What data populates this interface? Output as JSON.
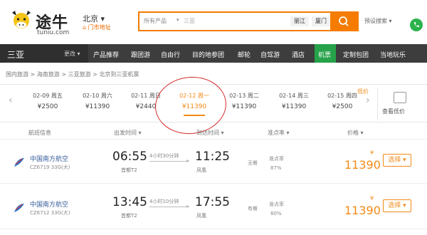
{
  "header": {
    "logo_cn": "途牛",
    "logo_en": "tuniu.com",
    "city": "北京 ▾",
    "city_sub": "⌂ 门市地址",
    "search": {
      "category": "所有产品",
      "value": "三亚",
      "tags": [
        "丽江",
        "厦门"
      ]
    },
    "link": "预设搜索 ▾"
  },
  "nav": {
    "city": "三亚",
    "change": "更改 ▾",
    "items": [
      "产品推荐",
      "跟团游",
      "自由行",
      "目的地参团",
      "邮轮",
      "自驾游",
      "酒店",
      "机票",
      "定制包团",
      "当地玩乐"
    ],
    "colors": {
      "active": "#26a24a",
      "bar": "#3d3d3d"
    }
  },
  "breadcrumb": "国内旅游 > 海南旅游 > 三亚旅游 > 北京到三亚机票",
  "dates": [
    {
      "label": "02-09 周五",
      "price": "¥2500"
    },
    {
      "label": "02-10 周六",
      "price": "¥11390"
    },
    {
      "label": "02-11 周日",
      "price": "¥2440"
    },
    {
      "label": "02-12 周一",
      "price": "¥11390"
    },
    {
      "label": "02-13 周二",
      "price": "¥11390"
    },
    {
      "label": "02-14 周三",
      "price": "¥11390"
    },
    {
      "label": "02-15 周四",
      "price": "¥2500"
    }
  ],
  "low_badge": "低价",
  "calendar_label": "查看低价",
  "table_header": [
    "航班信息",
    "出发时间 ▾",
    "到达时间 ▾",
    "准点率 ▾",
    "价格 ▾"
  ],
  "flights": [
    {
      "airline": "中国南方航空",
      "code": "CZ6719 33G(大)",
      "dep_time": "06:55",
      "dep_airport": "首都T2",
      "duration": "4小时30分钟",
      "arr_time": "11:25",
      "arr_airport": "凤凰",
      "meal": "无餐",
      "ontime_label": "准点率",
      "ontime": "87%",
      "price": "11390",
      "select": "选择 ▾"
    },
    {
      "airline": "中国南方航空",
      "code": "CZ6712 33G(大)",
      "dep_time": "13:45",
      "dep_airport": "首都T2",
      "duration": "4小时10分钟",
      "arr_time": "17:55",
      "arr_airport": "凤凰",
      "meal": "有餐",
      "ontime_label": "准点率",
      "ontime": "80%",
      "price": "11390",
      "select": "选择 ▾"
    }
  ],
  "colors": {
    "accent": "#f57c00",
    "price": "#f28a16",
    "annotation": "#d42b2b",
    "airline": "#355c9a"
  },
  "icons": [
    "cow-logo-icon",
    "search-icon",
    "phone-icon",
    "calendar-icon",
    "chevron-left-icon",
    "chevron-right-icon",
    "airline-logo-icon"
  ]
}
